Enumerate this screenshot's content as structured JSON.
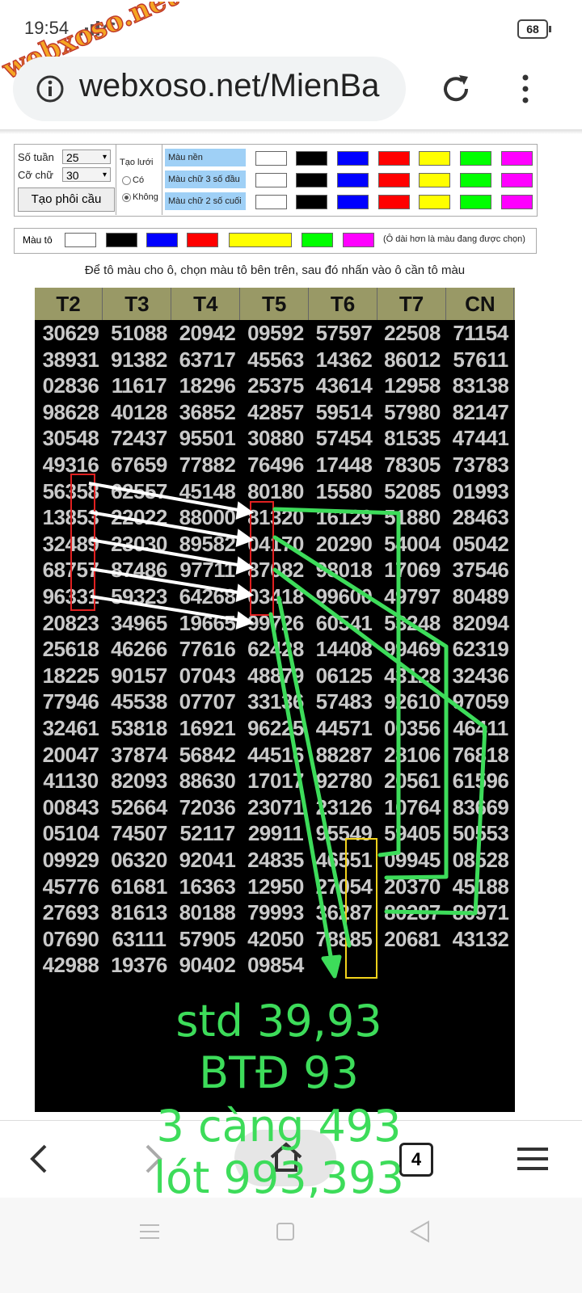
{
  "status": {
    "time": "19:54",
    "battery": "68",
    "watermark": "webxoso.net"
  },
  "browser": {
    "url": "webxoso.net/MienBa",
    "tabs_count": "4"
  },
  "controls": {
    "weeks_label": "Số tuần",
    "weeks_value": "25",
    "font_label": "Cỡ chữ",
    "font_value": "30",
    "create_button": "Tạo phôi cầu",
    "grid_label": "Tạo lưới",
    "grid_yes": "Có",
    "grid_no": "Không",
    "row_labels": [
      "Màu nền",
      "Màu chữ 3 số đầu",
      "Màu chữ 2 số cuối"
    ],
    "swatch_colors": [
      "#ffffff",
      "#000000",
      "#0000ff",
      "#ff0000",
      "#ffff00",
      "#00ff00",
      "#ff00ff"
    ],
    "paint_label": "Màu tô",
    "paint_note": "(Ô dài hơn là màu đang được chọn)",
    "instruction": "Để tô màu cho ô, chọn màu tô bên trên, sau đó nhấn vào ô cần tô màu"
  },
  "table": {
    "headers": [
      "T2",
      "T3",
      "T4",
      "T5",
      "T6",
      "T7",
      "CN"
    ],
    "rows": [
      [
        "30629",
        "51088",
        "20942",
        "09592",
        "57597",
        "22508",
        "71154"
      ],
      [
        "38931",
        "91382",
        "63717",
        "45563",
        "14362",
        "86012",
        "57611"
      ],
      [
        "02836",
        "11617",
        "18296",
        "25375",
        "43614",
        "12958",
        "83138"
      ],
      [
        "98628",
        "40128",
        "36852",
        "42857",
        "59514",
        "57980",
        "82147"
      ],
      [
        "30548",
        "72437",
        "95501",
        "30880",
        "57454",
        "81535",
        "47441"
      ],
      [
        "49316",
        "67659",
        "77882",
        "76496",
        "17448",
        "78305",
        "73783"
      ],
      [
        "56358",
        "62557",
        "45148",
        "80180",
        "15580",
        "52085",
        "01993"
      ],
      [
        "13853",
        "22022",
        "88000",
        "81320",
        "16129",
        "51880",
        "28463"
      ],
      [
        "32489",
        "23030",
        "89582",
        "04170",
        "20290",
        "54004",
        "05042"
      ],
      [
        "68757",
        "87486",
        "97711",
        "87082",
        "98018",
        "17069",
        "37546"
      ],
      [
        "96331",
        "59323",
        "64268",
        "03418",
        "99600",
        "49797",
        "80489"
      ],
      [
        "20823",
        "34965",
        "19665",
        "99726",
        "60541",
        "53248",
        "82094"
      ],
      [
        "25618",
        "46266",
        "77616",
        "62428",
        "14408",
        "99469",
        "62319"
      ],
      [
        "18225",
        "90157",
        "07043",
        "48879",
        "06125",
        "43128",
        "32436"
      ],
      [
        "77946",
        "45538",
        "07707",
        "33136",
        "57483",
        "92610",
        "97059"
      ],
      [
        "32461",
        "53818",
        "16921",
        "96225",
        "44571",
        "00356",
        "46411"
      ],
      [
        "20047",
        "37874",
        "56842",
        "44516",
        "88287",
        "28106",
        "76818"
      ],
      [
        "41130",
        "82093",
        "88630",
        "17017",
        "92780",
        "20561",
        "61596"
      ],
      [
        "00843",
        "52664",
        "72036",
        "23071",
        "23126",
        "10764",
        "83669"
      ],
      [
        "05104",
        "74507",
        "52117",
        "29911",
        "95549",
        "59405",
        "50553"
      ],
      [
        "09929",
        "06320",
        "92041",
        "24835",
        "46551",
        "09945",
        "08528"
      ],
      [
        "45776",
        "61681",
        "16363",
        "12950",
        "27054",
        "20370",
        "45188"
      ],
      [
        "27693",
        "81613",
        "80188",
        "79993",
        "36287",
        "80287",
        "86971"
      ],
      [
        "07690",
        "63111",
        "57905",
        "42050",
        "78885",
        "20681",
        "43132"
      ],
      [
        "42988",
        "19376",
        "90402",
        "09854",
        "",
        "",
        ""
      ]
    ]
  },
  "annotations": {
    "line1": "std 39,93",
    "line2": "BTĐ 93",
    "line3": "3 càng 493",
    "line4": "lót 993,393",
    "green": "#3ddc5a"
  }
}
